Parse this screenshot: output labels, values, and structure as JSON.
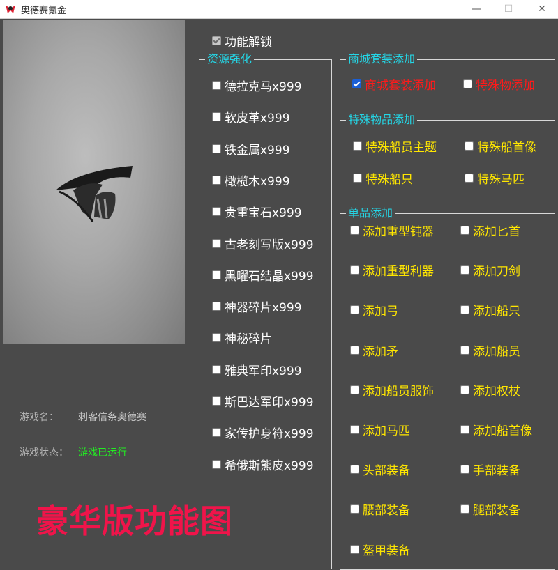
{
  "window": {
    "title": "奥德赛氪金",
    "min_glyph": "—",
    "max_glyph": "☐",
    "close_glyph": "✕"
  },
  "info": {
    "game_name_label": "游戏名：",
    "game_name_value": "刺客信条奥德赛",
    "game_status_label": "游戏状态：",
    "game_status_value": "游戏已运行"
  },
  "unlock": {
    "label": "功能解锁",
    "checked": true
  },
  "resources": {
    "title": "资源强化",
    "items": [
      "德拉克马x999",
      "软皮革x999",
      "铁金属x999",
      "橄榄木x999",
      "贵重宝石x999",
      "古老刻写版x999",
      "黑曜石结晶x999",
      "神器碎片x999",
      "神秘碎片",
      "雅典军印x999",
      "斯巴达军印x999",
      "家传护身符x999",
      "希俄斯熊皮x999"
    ]
  },
  "mall": {
    "title": "商城套装添加",
    "items": [
      {
        "label": "商城套装添加",
        "checked": true
      },
      {
        "label": "特殊物添加",
        "checked": false
      }
    ]
  },
  "special": {
    "title": "特殊物品添加",
    "items": [
      "特殊船员主题",
      "特殊船首像",
      "特殊船只",
      "特殊马匹"
    ]
  },
  "single": {
    "title": "单品添加",
    "items": [
      "添加重型钝器",
      "添加匕首",
      "添加重型利器",
      "添加刀剑",
      "添加弓",
      "添加船只",
      "添加矛",
      "添加船员",
      "添加船员服饰",
      "添加权杖",
      "添加马匹",
      "添加船首像",
      "头部装备",
      "手部装备",
      "腰部装备",
      "腿部装备",
      "盔甲装备"
    ]
  },
  "watermark": "豪华版功能图",
  "colors": {
    "background": "#4a4a4a",
    "group_title": "#24d6e6",
    "item_white": "#ffffff",
    "item_yellow": "#ffe600",
    "item_red": "#ff1a1a",
    "status_green": "#22ee22",
    "watermark": "#f0144a"
  }
}
